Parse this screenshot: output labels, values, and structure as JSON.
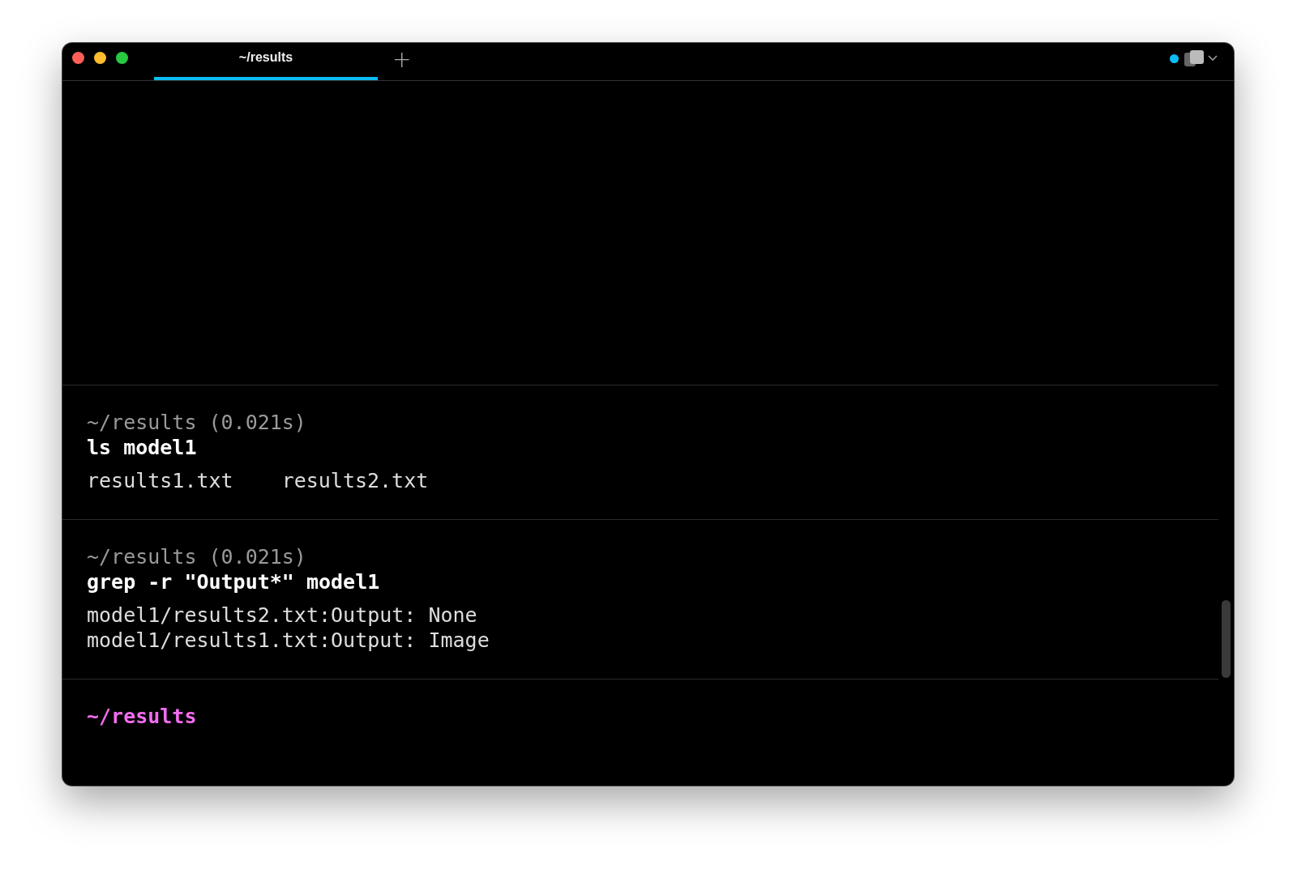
{
  "tabs": [
    {
      "label": "~/results",
      "selected": true
    }
  ],
  "new_tab": "+",
  "blocks": [
    {
      "header": "~/results (0.021s)",
      "command": "ls model1",
      "kind": "columns",
      "output": [
        "results1.txt",
        "results2.txt"
      ]
    },
    {
      "header": "~/results (0.021s)",
      "command": "grep -r \"Output*\" model1",
      "kind": "lines",
      "output": [
        "model1/results2.txt:Output: None",
        "model1/results1.txt:Output: Image"
      ]
    }
  ],
  "prompt": "~/results"
}
